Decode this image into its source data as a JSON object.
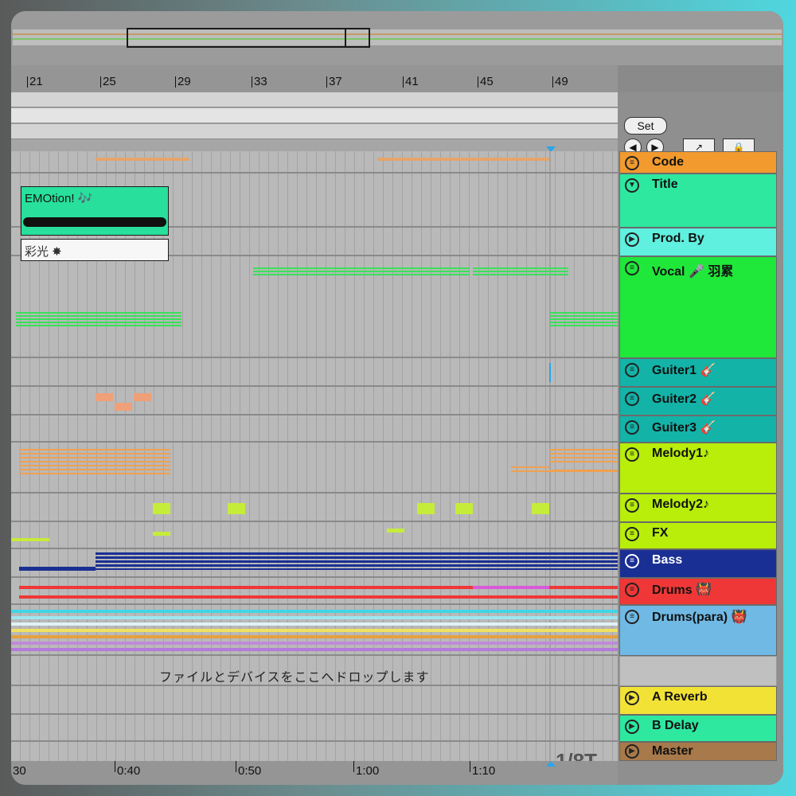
{
  "overview": {
    "label": "arrangement-overview"
  },
  "ruler": {
    "bars": [
      "21",
      "25",
      "29",
      "33",
      "37",
      "41",
      "45",
      "49"
    ]
  },
  "time_ruler": {
    "labels": [
      "30",
      "0:40",
      "0:50",
      "1:00",
      "1:10"
    ]
  },
  "controls": {
    "set_label": "Set",
    "prev": "◀",
    "next": "▶",
    "follow": "↗",
    "lock": "🔒"
  },
  "clips": {
    "emotion": {
      "name": "EMOtion! 🎶"
    },
    "saiko": {
      "name": "彩光 ✸"
    }
  },
  "drop_area": {
    "text": "ファイルとデバイスをここへドロップします"
  },
  "quantize": {
    "value": "1/8T"
  },
  "tracks": [
    {
      "name": "Code",
      "color": "#f29a2e",
      "icon": "≡"
    },
    {
      "name": "Title",
      "color": "#2ee8a0",
      "icon": "▼"
    },
    {
      "name": "Prod. By",
      "color": "#5ff0df",
      "icon": "▶"
    },
    {
      "name": "Vocal 🎤 羽累",
      "color": "#1fe83a",
      "icon": "≡"
    },
    {
      "name": "Guiter1 🎸",
      "color": "#13b3a8",
      "icon": "≡"
    },
    {
      "name": "Guiter2 🎸",
      "color": "#13b3a8",
      "icon": "≡"
    },
    {
      "name": "Guiter3 🎸",
      "color": "#13b3a8",
      "icon": "≡"
    },
    {
      "name": "Melody1♪",
      "color": "#b8ee0a",
      "icon": "≡"
    },
    {
      "name": "Melody2♪",
      "color": "#b8ee0a",
      "icon": "≡"
    },
    {
      "name": "FX",
      "color": "#b8ee0a",
      "icon": "≡"
    },
    {
      "name": "Bass",
      "color": "#1a2f94",
      "icon": "≡"
    },
    {
      "name": "Drums 👹",
      "color": "#ef3737",
      "icon": "≡"
    },
    {
      "name": "Drums(para) 👹",
      "color": "#70b9e4",
      "icon": "≡"
    }
  ],
  "returns": [
    {
      "name": "A Reverb",
      "color": "#f2e236",
      "icon": "▶"
    },
    {
      "name": "B Delay",
      "color": "#2ee8a0",
      "icon": "▶"
    },
    {
      "name": "Master",
      "color": "#a8794a",
      "icon": "▶"
    }
  ]
}
